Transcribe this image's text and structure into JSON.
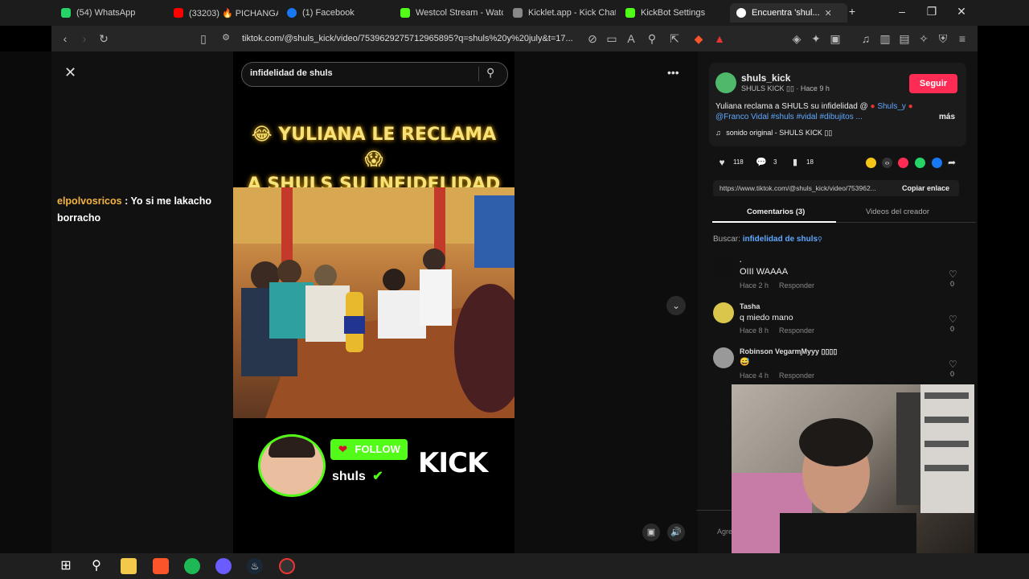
{
  "tabs": [
    {
      "label": "(54) WhatsApp",
      "color": "#25d366"
    },
    {
      "label": "(33203) 🔥 PICHANGA ...",
      "color": "#ff0000"
    },
    {
      "label": "(1) Facebook",
      "color": "#1877f2"
    },
    {
      "label": "Westcol Stream - Watc...",
      "color": "#53fc18"
    },
    {
      "label": "Kicklet.app - Kick Chatb...",
      "color": "#888888"
    },
    {
      "label": "KickBot Settings",
      "color": "#53fc18"
    },
    {
      "label": "Encuentra 'shul...",
      "color": "#ffffff"
    }
  ],
  "url": "tiktok.com/@shuls_kick/video/7539629275712965895?q=shuls%20y%20july&t=17...",
  "chat": {
    "user": "elpolvosricos",
    "message": "Yo si me lakacho borracho"
  },
  "video": {
    "search_value": "infidelidad de shuls",
    "title_line1": "😂 YULIANA LE RECLAMA 😱",
    "title_line2": "A SHULS SU INFIDELIDAD",
    "follow_label": "FOLLOW",
    "streamer_name": "shuls",
    "brand": "KICK"
  },
  "author": {
    "username": "shuls_kick",
    "subtitle": "SHULS KICK ▯▯ · Hace 9 h",
    "follow_button": "Seguir",
    "caption_line1": "Yuliana reclama a SHULS su infidelidad @",
    "caption_mention": "Shuls_y",
    "caption_line2": "@Franco Vidal #shuls #vidal #dibujitos ...",
    "more": "más",
    "sound": "sonido original - SHULS KICK ▯▯"
  },
  "stats": {
    "likes": "118",
    "comments": "3",
    "saves": "18"
  },
  "link": {
    "url": "https://www.tiktok.com/@shuls_kick/video/753962...",
    "copy_label": "Copiar enlace"
  },
  "tabs_panel": {
    "comments": "Comentarios (3)",
    "creator_videos": "Videos del creador"
  },
  "search_hint": {
    "prefix": "Buscar:",
    "query": "infidelidad de shuls"
  },
  "comments": [
    {
      "name": ".",
      "text": "OIII WAAAA",
      "time": "Hace 2 h",
      "reply": "Responder",
      "likes": "0",
      "avatar": "#111111"
    },
    {
      "name": "Tasha",
      "text": "q miedo mano",
      "time": "Hace 8 h",
      "reply": "Responder",
      "likes": "0",
      "avatar": "#d9c64a"
    },
    {
      "name": "Robinson Vegarm̧Myyy ▯▯▯▯",
      "text": "😅",
      "time": "Hace 4 h",
      "reply": "Responder",
      "likes": "0",
      "avatar": "#999999"
    }
  ],
  "add_comment_placeholder": "Agre"
}
